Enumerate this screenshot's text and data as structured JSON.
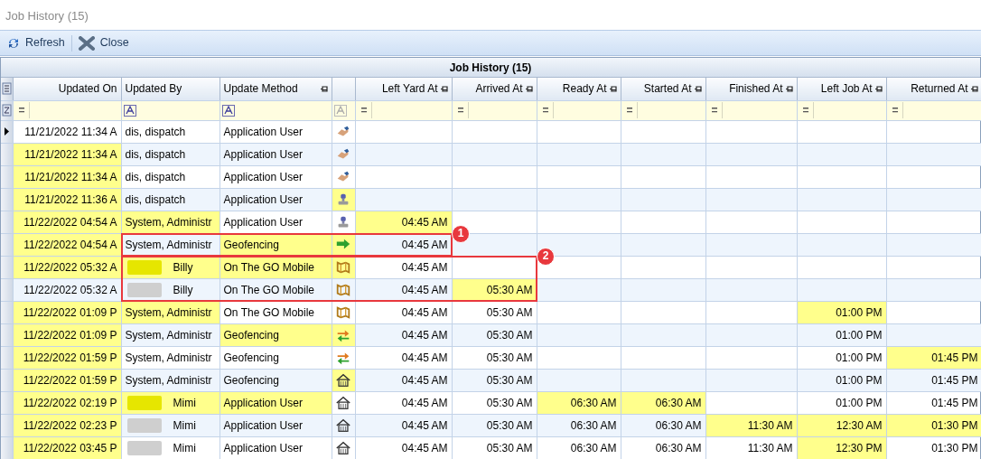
{
  "window": {
    "title": "Job History (15)"
  },
  "toolbar": [
    {
      "label": "Refresh",
      "kind": "refresh"
    },
    {
      "label": "Close",
      "kind": "close"
    }
  ],
  "grid": {
    "caption": "Job History (15)",
    "columns": [
      {
        "label": "Updated On",
        "filter": {
          "kind": "operator",
          "text": "="
        }
      },
      {
        "label": "Updated By",
        "filter": {
          "kind": "text"
        }
      },
      {
        "label": "Update Method",
        "filter": {
          "kind": "text"
        },
        "pinned": true
      },
      {
        "filter": {
          "kind": "text",
          "disabled": true
        }
      },
      {
        "label": "Left Yard At",
        "filter": {
          "kind": "operator",
          "text": "="
        },
        "pinned": true
      },
      {
        "label": "Arrived At",
        "filter": {
          "kind": "operator",
          "text": "="
        },
        "pinned": true
      },
      {
        "label": "Ready At",
        "filter": {
          "kind": "operator",
          "text": "="
        },
        "pinned": true
      },
      {
        "label": "Started At",
        "filter": {
          "kind": "operator",
          "text": "="
        },
        "pinned": true
      },
      {
        "label": "Finished At",
        "filter": {
          "kind": "operator",
          "text": "="
        },
        "pinned": true
      },
      {
        "label": "Left Job At",
        "filter": {
          "kind": "operator",
          "text": "="
        },
        "pinned": true
      },
      {
        "label": "Returned At",
        "filter": {
          "kind": "operator",
          "text": "="
        },
        "pinned": true
      }
    ],
    "rows": [
      {
        "current": true,
        "updated_on": {
          "text": "11/21/2022 11:34 A",
          "highlighted": false
        },
        "updated_by": {
          "text": "dis, dispatch",
          "highlighted": false
        },
        "method": {
          "text": "Application User",
          "highlighted": false
        },
        "icon": {
          "kind": "handshake",
          "highlighted": false
        }
      },
      {
        "current": false,
        "updated_on": {
          "text": "11/21/2022 11:34 A",
          "highlighted": true
        },
        "updated_by": {
          "text": "dis, dispatch",
          "highlighted": false
        },
        "method": {
          "text": "Application User",
          "highlighted": false
        },
        "icon": {
          "kind": "handshake",
          "highlighted": false
        }
      },
      {
        "current": false,
        "updated_on": {
          "text": "11/21/2022 11:34 A",
          "highlighted": true
        },
        "updated_by": {
          "text": "dis, dispatch",
          "highlighted": false
        },
        "method": {
          "text": "Application User",
          "highlighted": false
        },
        "icon": {
          "kind": "handshake",
          "highlighted": false
        }
      },
      {
        "current": false,
        "updated_on": {
          "text": "11/21/2022 11:36 A",
          "highlighted": true
        },
        "updated_by": {
          "text": "dis, dispatch",
          "highlighted": false
        },
        "method": {
          "text": "Application User",
          "highlighted": false
        },
        "icon": {
          "kind": "stamp",
          "highlighted": true
        }
      },
      {
        "current": false,
        "updated_on": {
          "text": "11/22/2022 04:54 A",
          "highlighted": true
        },
        "updated_by": {
          "text": "System, Administr",
          "highlighted": true
        },
        "method": {
          "text": "Application User",
          "highlighted": false
        },
        "icon": {
          "kind": "stamp",
          "highlighted": false
        },
        "left_yard_at": {
          "text": "04:45 AM",
          "highlighted": true
        }
      },
      {
        "current": false,
        "updated_on": {
          "text": "11/22/2022 04:54 A",
          "highlighted": true
        },
        "updated_by": {
          "text": "System, Administr",
          "highlighted": false
        },
        "method": {
          "text": "Geofencing",
          "highlighted": true
        },
        "icon": {
          "kind": "arrow",
          "highlighted": true
        },
        "left_yard_at": {
          "text": "04:45 AM",
          "highlighted": false
        }
      },
      {
        "current": false,
        "updated_on": {
          "text": "11/22/2022 05:32 A",
          "highlighted": true
        },
        "updated_by": {
          "text": "Billy",
          "highlighted": true,
          "redacted": true
        },
        "method": {
          "text": "On The GO Mobile",
          "highlighted": true
        },
        "icon": {
          "kind": "map",
          "highlighted": true
        },
        "left_yard_at": {
          "text": "04:45 AM",
          "highlighted": false
        }
      },
      {
        "current": false,
        "updated_on": {
          "text": "11/22/2022 05:32 A",
          "highlighted": false
        },
        "updated_by": {
          "text": "Billy",
          "highlighted": false,
          "redacted": true
        },
        "method": {
          "text": "On The GO Mobile",
          "highlighted": false
        },
        "icon": {
          "kind": "map",
          "highlighted": false
        },
        "left_yard_at": {
          "text": "04:45 AM",
          "highlighted": false
        },
        "arrived_at": {
          "text": "05:30 AM",
          "highlighted": true
        }
      },
      {
        "current": false,
        "updated_on": {
          "text": "11/22/2022 01:09 P",
          "highlighted": true
        },
        "updated_by": {
          "text": "System, Administr",
          "highlighted": true
        },
        "method": {
          "text": "On The GO Mobile",
          "highlighted": false
        },
        "icon": {
          "kind": "map",
          "highlighted": false
        },
        "left_yard_at": {
          "text": "04:45 AM",
          "highlighted": false
        },
        "arrived_at": {
          "text": "05:30 AM",
          "highlighted": false
        },
        "left_job_at": {
          "text": "01:00 PM",
          "highlighted": true
        }
      },
      {
        "current": false,
        "updated_on": {
          "text": "11/22/2022 01:09 P",
          "highlighted": true
        },
        "updated_by": {
          "text": "System, Administr",
          "highlighted": false
        },
        "method": {
          "text": "Geofencing",
          "highlighted": true
        },
        "icon": {
          "kind": "swap",
          "highlighted": true
        },
        "left_yard_at": {
          "text": "04:45 AM",
          "highlighted": false
        },
        "arrived_at": {
          "text": "05:30 AM",
          "highlighted": false
        },
        "left_job_at": {
          "text": "01:00 PM",
          "highlighted": false
        }
      },
      {
        "current": false,
        "updated_on": {
          "text": "11/22/2022 01:59 P",
          "highlighted": true
        },
        "updated_by": {
          "text": "System, Administr",
          "highlighted": false
        },
        "method": {
          "text": "Geofencing",
          "highlighted": false
        },
        "icon": {
          "kind": "swap",
          "highlighted": false
        },
        "left_yard_at": {
          "text": "04:45 AM",
          "highlighted": false
        },
        "arrived_at": {
          "text": "05:30 AM",
          "highlighted": false
        },
        "left_job_at": {
          "text": "01:00 PM",
          "highlighted": false
        },
        "returned_at": {
          "text": "01:45 PM",
          "highlighted": true
        }
      },
      {
        "current": false,
        "updated_on": {
          "text": "11/22/2022 01:59 P",
          "highlighted": true
        },
        "updated_by": {
          "text": "System, Administr",
          "highlighted": false
        },
        "method": {
          "text": "Geofencing",
          "highlighted": false
        },
        "icon": {
          "kind": "house",
          "highlighted": true
        },
        "left_yard_at": {
          "text": "04:45 AM",
          "highlighted": false
        },
        "arrived_at": {
          "text": "05:30 AM",
          "highlighted": false
        },
        "left_job_at": {
          "text": "01:00 PM",
          "highlighted": false
        },
        "returned_at": {
          "text": "01:45 PM",
          "highlighted": false
        }
      },
      {
        "current": false,
        "updated_on": {
          "text": "11/22/2022 02:19 P",
          "highlighted": true
        },
        "updated_by": {
          "text": "Mimi",
          "highlighted": true,
          "redacted": true
        },
        "method": {
          "text": "Application User",
          "highlighted": true
        },
        "icon": {
          "kind": "house",
          "highlighted": false
        },
        "left_yard_at": {
          "text": "04:45 AM",
          "highlighted": false
        },
        "arrived_at": {
          "text": "05:30 AM",
          "highlighted": false
        },
        "ready_at": {
          "text": "06:30 AM",
          "highlighted": true
        },
        "started_at": {
          "text": "06:30 AM",
          "highlighted": true
        },
        "left_job_at": {
          "text": "01:00 PM",
          "highlighted": false
        },
        "returned_at": {
          "text": "01:45 PM",
          "highlighted": false
        }
      },
      {
        "current": false,
        "updated_on": {
          "text": "11/22/2022 02:23 P",
          "highlighted": true
        },
        "updated_by": {
          "text": "Mimi",
          "highlighted": false,
          "redacted": true
        },
        "method": {
          "text": "Application User",
          "highlighted": false
        },
        "icon": {
          "kind": "house",
          "highlighted": false
        },
        "left_yard_at": {
          "text": "04:45 AM",
          "highlighted": false
        },
        "arrived_at": {
          "text": "05:30 AM",
          "highlighted": false
        },
        "ready_at": {
          "text": "06:30 AM",
          "highlighted": false
        },
        "started_at": {
          "text": "06:30 AM",
          "highlighted": false
        },
        "finished_at": {
          "text": "11:30 AM",
          "highlighted": true
        },
        "left_job_at": {
          "text": "12:30 AM",
          "highlighted": true
        },
        "returned_at": {
          "text": "01:30 PM",
          "highlighted": true
        }
      },
      {
        "current": false,
        "updated_on": {
          "text": "11/22/2022 03:45 P",
          "highlighted": true
        },
        "updated_by": {
          "text": "Mimi",
          "highlighted": false,
          "redacted": true
        },
        "method": {
          "text": "Application User",
          "highlighted": false
        },
        "icon": {
          "kind": "house",
          "highlighted": false
        },
        "left_yard_at": {
          "text": "04:45 AM",
          "highlighted": false
        },
        "arrived_at": {
          "text": "05:30 AM",
          "highlighted": false
        },
        "ready_at": {
          "text": "06:30 AM",
          "highlighted": false
        },
        "started_at": {
          "text": "06:30 AM",
          "highlighted": false
        },
        "finished_at": {
          "text": "11:30 AM",
          "highlighted": false
        },
        "left_job_at": {
          "text": "12:30 PM",
          "highlighted": true
        },
        "returned_at": {
          "text": "01:30 PM",
          "highlighted": false
        }
      }
    ]
  },
  "callouts": [
    {
      "label": "1"
    },
    {
      "label": "2"
    }
  ]
}
